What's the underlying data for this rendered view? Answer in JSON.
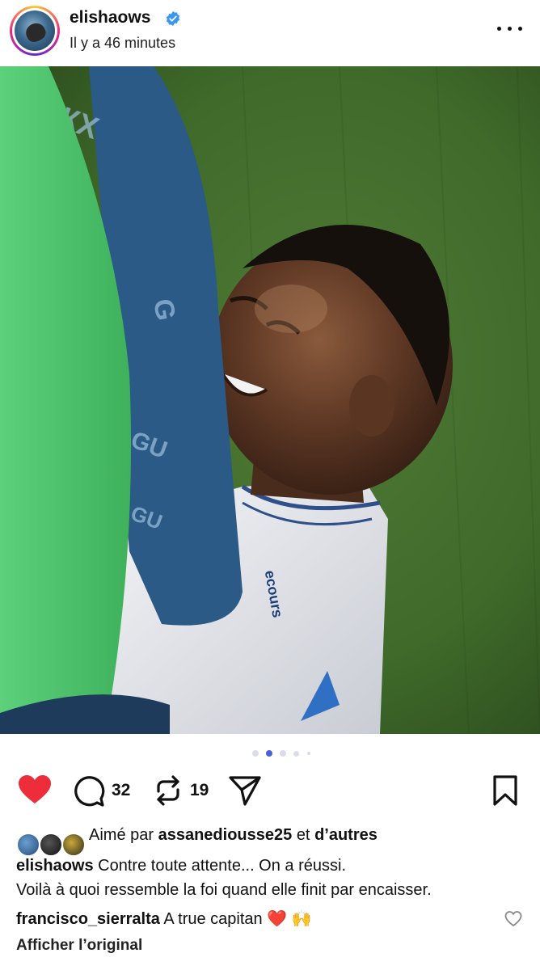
{
  "post": {
    "username": "elishaows",
    "time_ago": "Il y a 46 minutes",
    "verified": true
  },
  "carousel": {
    "count": 5,
    "active_index": 1
  },
  "actions": {
    "comments_count": "32",
    "reposts_count": "19",
    "like_color": "#ed2d3a"
  },
  "likes": {
    "prefix": "Aimé par",
    "user": "assanediousse25",
    "joiner": "et",
    "others": "d’autres"
  },
  "caption": {
    "username": "elishaows",
    "line1": "Contre toute attente... On a réussi.",
    "line2": "Voilà à quoi ressemble la foi quand elle finit par encaisser."
  },
  "comment": {
    "username": "francisco_sierralta",
    "text": "A true capitan ❤️ 🙌"
  },
  "translate_label": "Afficher l’original",
  "colors": {
    "verified_blue": "#3897f0",
    "dot_active": "#4a5fe0",
    "dot_inactive": "#dadde6"
  }
}
